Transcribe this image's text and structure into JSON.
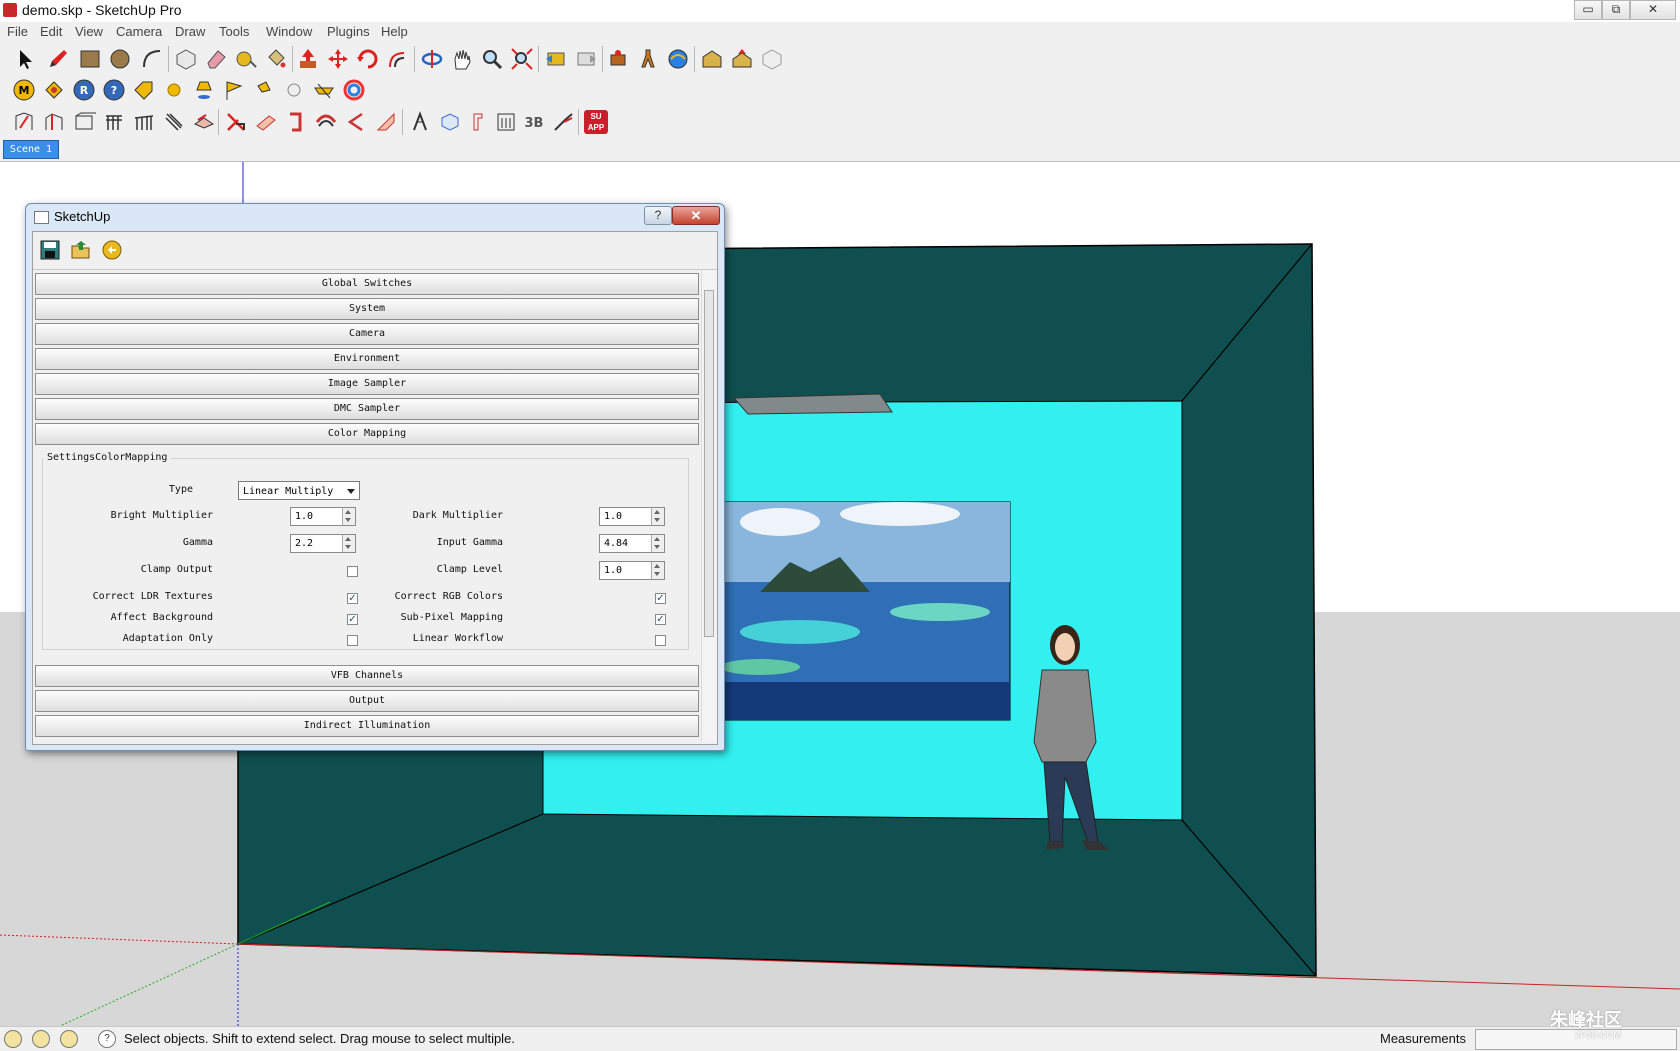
{
  "window": {
    "title": "demo.skp - SketchUp Pro",
    "controls": {
      "minimize": "▭",
      "maximize": "⧉",
      "close": "✕"
    }
  },
  "menu": [
    "File",
    "Edit",
    "View",
    "Camera",
    "Draw",
    "Tools",
    "Window",
    "Plugins",
    "Help"
  ],
  "toolbars": {
    "row1": [
      "select-tool-icon",
      "pencil-tool-icon",
      "rectangle-tool-icon",
      "circle-tool-icon",
      "arc-tool-icon",
      "make-component-icon",
      "eraser-tool-icon",
      "tape-measure-icon",
      "paint-bucket-icon",
      "push-pull-icon",
      "move-tool-icon",
      "rotate-tool-icon",
      "offset-tool-icon",
      "orbit-tool-icon",
      "pan-tool-icon",
      "zoom-tool-icon",
      "zoom-extents-icon",
      "previous-view-icon",
      "next-view-icon",
      "position-camera-icon",
      "walk-tool-icon",
      "look-around-icon",
      "warehouse-icon",
      "share-model-icon",
      "extension-icon"
    ],
    "row2": [
      "vray-material-editor-icon",
      "vray-options-icon",
      "vray-render-icon",
      "vray-help-icon",
      "vray-tag-icon",
      "vray-sphere-light-icon",
      "vray-spot-light-icon",
      "vray-plane-light-icon",
      "vray-ies-light-icon",
      "vray-omni-light-icon",
      "vray-dome-light-icon",
      "vray-infinite-plane-icon"
    ],
    "row3": [
      "plugin-tool-1-icon",
      "plugin-tool-2-icon",
      "plugin-tool-3-icon",
      "plugin-tool-4-icon",
      "plugin-tool-5-icon",
      "plugin-tool-6-icon",
      "plugin-tool-7-icon",
      "plugin-tool-8-icon",
      "plugin-tool-9-icon",
      "plugin-tool-10-icon",
      "plugin-tool-11-icon",
      "plugin-tool-12-icon",
      "plugin-tool-13-icon",
      "plugin-tool-14-icon",
      "plugin-tool-15-icon",
      "plugin-tool-16-icon",
      "plugin-tool-17-icon",
      "plugin-tool-18-icon",
      "plugin-tool-19-icon",
      "plugin-tool-20-icon"
    ],
    "su_app_label": "SU APP"
  },
  "scene_tab": "Scene 1",
  "dialog": {
    "title": "SketchUp",
    "help": "?",
    "close": "✕",
    "sections_top": [
      "Global Switches",
      "System",
      "Camera",
      "Environment",
      "Image Sampler",
      "DMC Sampler",
      "Color Mapping"
    ],
    "group_title": "SettingsColorMapping",
    "type_label": "Type",
    "type_value": "Linear Multiply",
    "left_fields": [
      {
        "label": "Bright Multiplier",
        "value": "1.0"
      },
      {
        "label": "Gamma",
        "value": "2.2"
      }
    ],
    "right_fields": [
      {
        "label": "Dark Multiplier",
        "value": "1.0"
      },
      {
        "label": "Input Gamma",
        "value": "4.84"
      },
      {
        "label": "Clamp Level",
        "value": "1.0"
      }
    ],
    "left_checks": [
      {
        "label": "Clamp Output",
        "checked": false
      },
      {
        "label": "Correct LDR Textures",
        "checked": true
      },
      {
        "label": "Affect Background",
        "checked": true
      },
      {
        "label": "Adaptation Only",
        "checked": false
      }
    ],
    "right_checks": [
      {
        "label": "Correct RGB Colors",
        "checked": true
      },
      {
        "label": "Sub-Pixel Mapping",
        "checked": true
      },
      {
        "label": "Linear Workflow",
        "checked": false
      }
    ],
    "sections_bottom": [
      "VFB Channels",
      "Output",
      "Indirect Illumination"
    ]
  },
  "status": {
    "text": "Select objects. Shift to extend select. Drag mouse to select multiple.",
    "measurements_label": "Measurements",
    "measurements_value": ""
  },
  "watermark": {
    "main": "朱峰社区",
    "sub": "ZF3D.COM"
  },
  "colors": {
    "room_dark": "#0f4f4f",
    "room_light": "#32f0f0",
    "ground": "#d7d7d7",
    "sky": "#ffffff",
    "accent": "#3a8ee8"
  }
}
